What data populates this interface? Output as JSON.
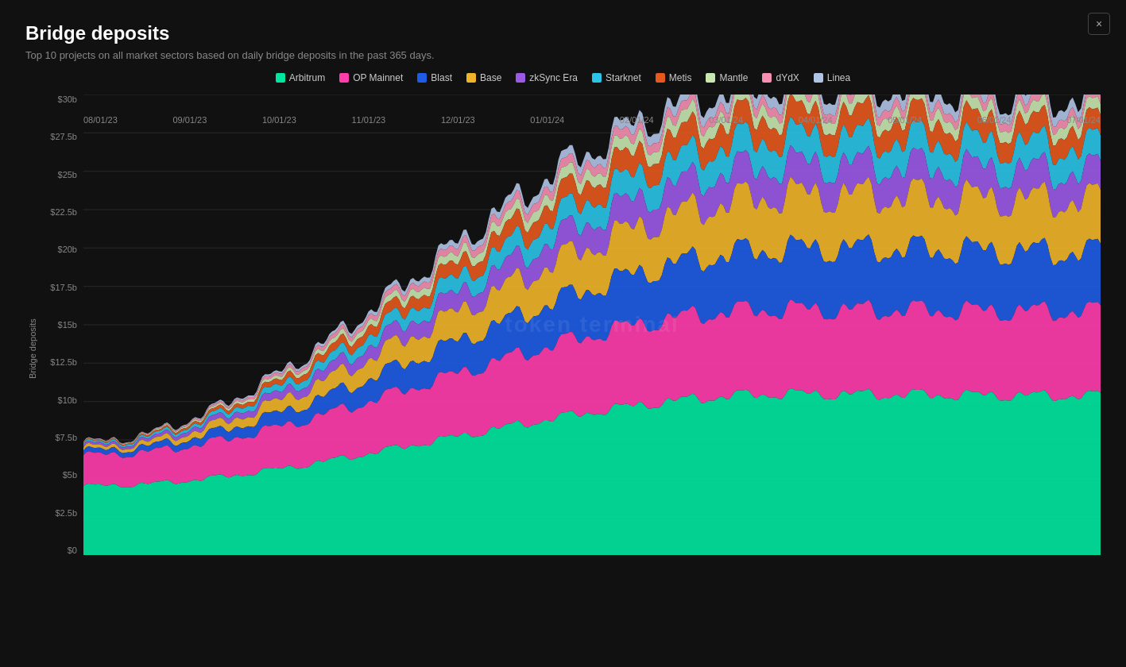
{
  "header": {
    "title": "Bridge deposits",
    "subtitle": "Top 10 projects on all market sectors based on daily bridge deposits in the past 365 days.",
    "close_label": "×"
  },
  "legend": [
    {
      "label": "Arbitrum",
      "color": "#00e6a0"
    },
    {
      "label": "OP Mainnet",
      "color": "#ff3cac"
    },
    {
      "label": "Blast",
      "color": "#1e5ce6"
    },
    {
      "label": "Base",
      "color": "#f0b429"
    },
    {
      "label": "zkSync Era",
      "color": "#9b59e6"
    },
    {
      "label": "Starknet",
      "color": "#2bc4e6"
    },
    {
      "label": "Metis",
      "color": "#e6581e"
    },
    {
      "label": "Mantle",
      "color": "#c8e6b0"
    },
    {
      "label": "dYdX",
      "color": "#f78fb3"
    },
    {
      "label": "Linea",
      "color": "#b0c4e6"
    }
  ],
  "y_axis": {
    "label": "Bridge deposits",
    "ticks": [
      "$0",
      "$2.5b",
      "$5b",
      "$7.5b",
      "$10b",
      "$12.5b",
      "$15b",
      "$17.5b",
      "$20b",
      "$22.5b",
      "$25b",
      "$27.5b",
      "$30b"
    ]
  },
  "x_axis": {
    "ticks": [
      "08/01/23",
      "09/01/23",
      "10/01/23",
      "11/01/23",
      "12/01/23",
      "01/01/24",
      "02/01/24",
      "03/01/24",
      "04/01/24",
      "05/01/24",
      "06/01/24",
      "07/01/24"
    ]
  },
  "watermark": "token terminal"
}
